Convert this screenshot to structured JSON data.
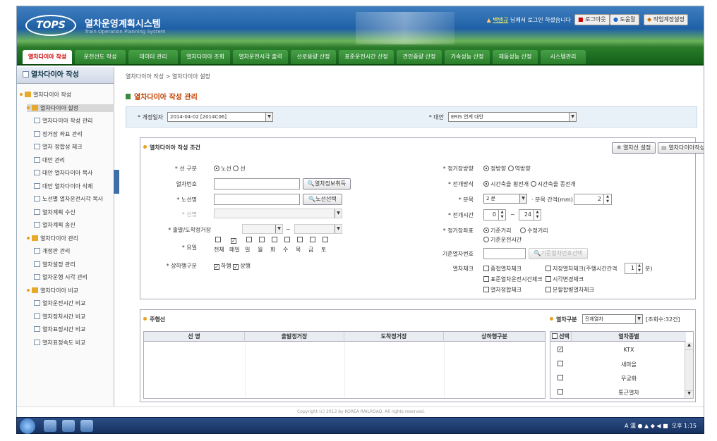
{
  "header": {
    "logo": "TOPS",
    "title": "열차운영계획시스템",
    "subtitle": "Train Operation Planning System",
    "user_name": "백맹규",
    "user_msg": "님께서 로그인 하셨습니다",
    "logout": "로그아웃",
    "help": "도움말",
    "settings": "작업계정설정"
  },
  "nav": {
    "tabs": [
      "열차다이아 작성",
      "운전선도 작성",
      "데이터 관리",
      "열차다이아 조회",
      "열차운전시각 출력",
      "선로용량 산정",
      "표준운전시간 산정",
      "견인중량 산정",
      "가속성능 산정",
      "제동성능 산정",
      "시스템관리"
    ]
  },
  "sidebar": {
    "title": "열차다이아 작성",
    "items": [
      {
        "label": "열차다이아 작성",
        "type": "folder",
        "level": 0
      },
      {
        "label": "열차다이아 설정",
        "type": "folder",
        "level": 1,
        "selected": true
      },
      {
        "label": "열차다이아 작성 관리",
        "type": "doc",
        "level": 2
      },
      {
        "label": "정거장 좌표 관리",
        "type": "doc",
        "level": 2
      },
      {
        "label": "열차 정합성 체크",
        "type": "doc",
        "level": 2
      },
      {
        "label": "대안 관리",
        "type": "doc",
        "level": 2
      },
      {
        "label": "대안 열차다이아 복사",
        "type": "doc",
        "level": 2
      },
      {
        "label": "대안 열차다이아 삭제",
        "type": "doc",
        "level": 2
      },
      {
        "label": "노선별 열차운전시각 복사",
        "type": "doc",
        "level": 2
      },
      {
        "label": "열차계획 수신",
        "type": "doc",
        "level": 2
      },
      {
        "label": "열차계획 송신",
        "type": "doc",
        "level": 2
      },
      {
        "label": "열차다이아 관리",
        "type": "folder",
        "level": 1
      },
      {
        "label": "개정판 관리",
        "type": "doc",
        "level": 2
      },
      {
        "label": "열차설정 관리",
        "type": "doc",
        "level": 2
      },
      {
        "label": "열차운행 시각 관리",
        "type": "doc",
        "level": 2
      },
      {
        "label": "열차다이아 비교",
        "type": "folder",
        "level": 1
      },
      {
        "label": "열차운전시간 비교",
        "type": "doc",
        "level": 2
      },
      {
        "label": "열차정차시간 비교",
        "type": "doc",
        "level": 2
      },
      {
        "label": "열차표정시간 비교",
        "type": "doc",
        "level": 2
      },
      {
        "label": "열차표정속도 비교",
        "type": "doc",
        "level": 2
      }
    ]
  },
  "main": {
    "breadcrumb": "열차다이아 작성 > 열차다이아 설정",
    "title": "열차다이아 작성 관리",
    "filter": {
      "rev_date_label": "* 개정일자",
      "rev_date_value": "2014-04-02 [2014C06]",
      "alt_label": "* 대안",
      "alt_value": "ERIS 연계 대안"
    },
    "cond": {
      "title": "열차다이아 작성 조건",
      "btn_line_set": "열차선 설정",
      "btn_create": "열차다이아작성",
      "line_type_label": "* 선 구분",
      "line_opt1": "노선",
      "line_opt2": "선",
      "train_no_label": "열차번호",
      "train_info_btn": "열차정보취득",
      "route_label": "* 노선명",
      "route_btn": "노선선택",
      "line_label": "* 선명",
      "dep_arr_label": "* 출발/도착정거장",
      "range_sep": "~",
      "day_label": "* 요일",
      "days": [
        "전체",
        "매일",
        "일",
        "월",
        "화",
        "수",
        "목",
        "금",
        "토"
      ],
      "day_checks": [
        false,
        true,
        false,
        false,
        false,
        false,
        false,
        false,
        false
      ],
      "updown_label": "* 상하행구분",
      "down_label": "하행",
      "up_label": "상행",
      "station_dir_label": "* 정거장방향",
      "dir_opt1": "정방향",
      "dir_opt2": "역방향",
      "draw_method_label": "* 전개방식",
      "draw_opt1": "시간축을 횡전개",
      "draw_opt2": "시간축을 종전개",
      "division_label": "* 분목",
      "division_value": "2 분",
      "division_interval_label": "· 분목 간격(mm)",
      "division_interval_value": "2",
      "draw_time_label": "* 전개시간",
      "draw_time_from": "0",
      "draw_time_to": "24",
      "station_coord_label": "* 정거장좌표",
      "coord_opt1": "기준거리",
      "coord_opt2": "수정거리",
      "coord_opt3": "기준운전시간",
      "base_train_label": "기준열차번호",
      "base_train_btn": "기준열차번호선택",
      "check_label": "열차체크",
      "checks": [
        "중첩열차체크",
        "지장열차체크(주행시간간격",
        "표준열차운전시간체크",
        "시각변경체크",
        "열차정합체크",
        "분할합병열차체크"
      ],
      "interval_value": "1",
      "interval_unit": "분)"
    },
    "lines": {
      "title": "주행선",
      "columns": [
        "선 명",
        "출발정거장",
        "도착정거장",
        "상하행구분"
      ],
      "class_label": "열차구분",
      "class_value": "전체열차",
      "count": "[조회수:32건]",
      "cls_columns": [
        "선택",
        "열차종별"
      ],
      "cls_rows": [
        {
          "name": "KTX",
          "checked": true
        },
        {
          "name": "새마을",
          "checked": false
        },
        {
          "name": "무궁화",
          "checked": false
        },
        {
          "name": "통근열차",
          "checked": false
        }
      ]
    },
    "copyright": "Copyright (c) 2013 by KOREA RAILROAD. All rights reserved."
  },
  "taskbar": {
    "tray_text": "A 漢",
    "clock": "오후 1:15"
  }
}
